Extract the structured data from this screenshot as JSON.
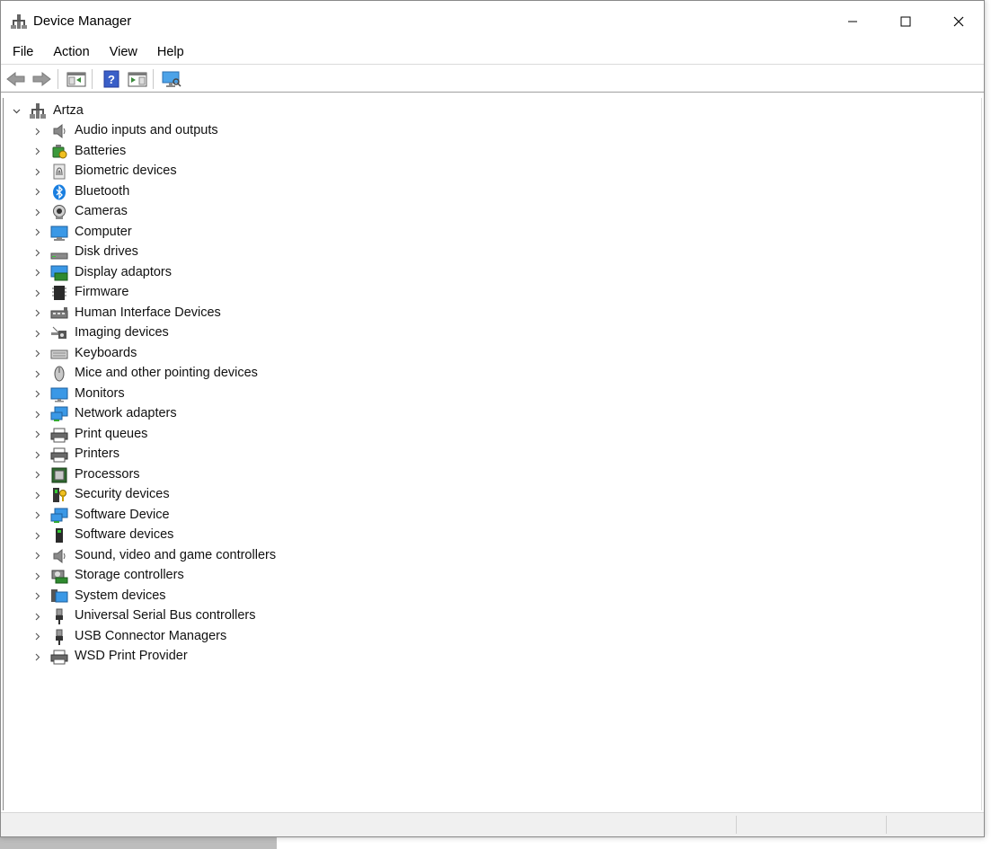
{
  "window": {
    "title": "Device Manager",
    "controls": {
      "minimize": "minimize",
      "maximize": "maximize",
      "close": "close"
    }
  },
  "menubar": {
    "items": [
      "File",
      "Action",
      "View",
      "Help"
    ]
  },
  "toolbar": {
    "buttons": [
      "back-arrow-icon",
      "forward-arrow-icon",
      "properties-icon",
      "help-icon",
      "update-driver-icon",
      "scan-hardware-icon"
    ]
  },
  "tree": {
    "root": {
      "label": "Artza",
      "expanded": true
    },
    "categories": [
      {
        "label": "Audio inputs and outputs",
        "icon": "speaker-icon"
      },
      {
        "label": "Batteries",
        "icon": "battery-icon"
      },
      {
        "label": "Biometric devices",
        "icon": "fingerprint-icon"
      },
      {
        "label": "Bluetooth",
        "icon": "bluetooth-icon"
      },
      {
        "label": "Cameras",
        "icon": "camera-icon"
      },
      {
        "label": "Computer",
        "icon": "computer-icon"
      },
      {
        "label": "Disk drives",
        "icon": "disk-drive-icon"
      },
      {
        "label": "Display adaptors",
        "icon": "display-adapter-icon"
      },
      {
        "label": "Firmware",
        "icon": "firmware-icon"
      },
      {
        "label": "Human Interface Devices",
        "icon": "hid-icon"
      },
      {
        "label": "Imaging devices",
        "icon": "imaging-icon"
      },
      {
        "label": "Keyboards",
        "icon": "keyboard-icon"
      },
      {
        "label": "Mice and other pointing devices",
        "icon": "mouse-icon"
      },
      {
        "label": "Monitors",
        "icon": "monitor-icon"
      },
      {
        "label": "Network adapters",
        "icon": "network-icon"
      },
      {
        "label": "Print queues",
        "icon": "printer-icon"
      },
      {
        "label": "Printers",
        "icon": "printer-icon"
      },
      {
        "label": "Processors",
        "icon": "processor-icon"
      },
      {
        "label": "Security devices",
        "icon": "security-icon"
      },
      {
        "label": "Software Device",
        "icon": "network-icon"
      },
      {
        "label": "Software devices",
        "icon": "software-device-icon"
      },
      {
        "label": "Sound, video and game controllers",
        "icon": "speaker-icon"
      },
      {
        "label": "Storage controllers",
        "icon": "storage-icon"
      },
      {
        "label": "System devices",
        "icon": "system-icon"
      },
      {
        "label": "Universal Serial Bus controllers",
        "icon": "usb-icon"
      },
      {
        "label": "USB Connector Managers",
        "icon": "usb-icon"
      },
      {
        "label": "WSD Print Provider",
        "icon": "printer-icon"
      }
    ]
  }
}
